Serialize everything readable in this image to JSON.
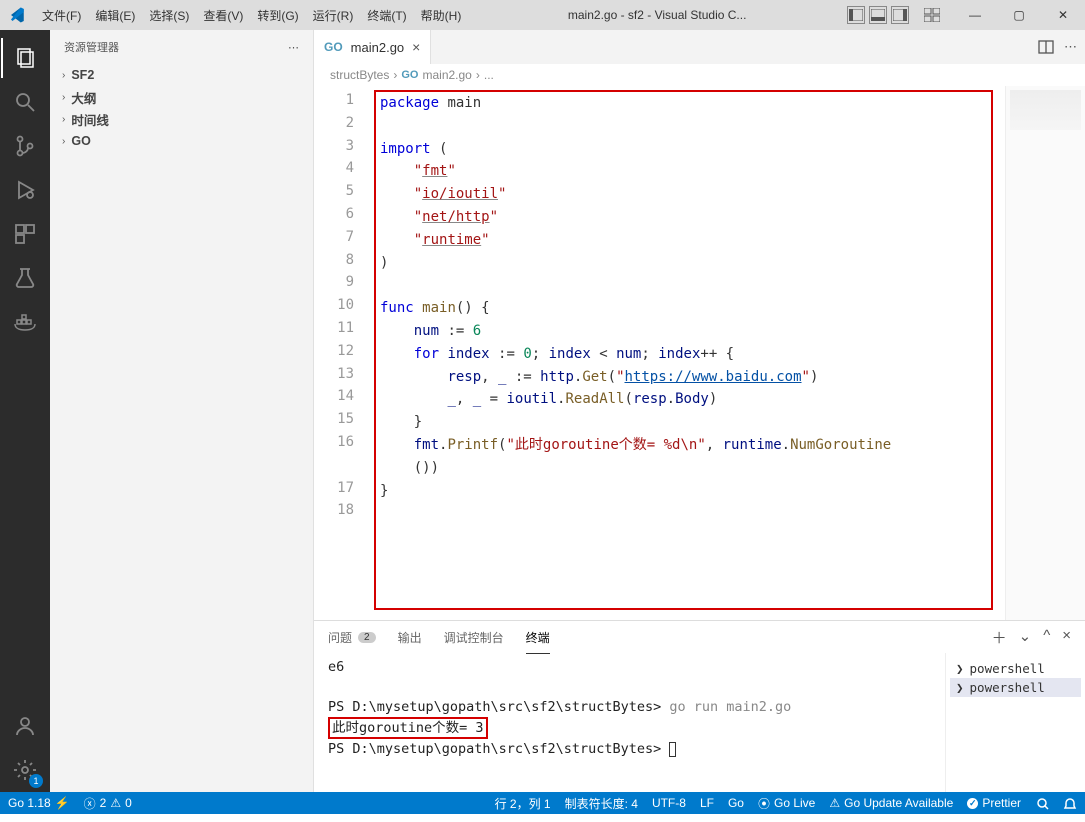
{
  "titlebar": {
    "menus": [
      "文件(F)",
      "编辑(E)",
      "选择(S)",
      "查看(V)",
      "转到(G)",
      "运行(R)",
      "终端(T)",
      "帮助(H)"
    ],
    "title": "main2.go - sf2 - Visual Studio C..."
  },
  "sidebar": {
    "title": "资源管理器",
    "sections": [
      "SF2",
      "大纲",
      "时间线",
      "GO"
    ]
  },
  "tab": {
    "icon": "GO",
    "name": "main2.go"
  },
  "breadcrumb": {
    "p0": "structBytes",
    "icon": "GO",
    "p1": "main2.go",
    "tail": "..."
  },
  "code": {
    "lines": 18,
    "l1": {
      "a": "package",
      "b": " main"
    },
    "l3": {
      "a": "import",
      "b": " ("
    },
    "l4": {
      "pad": "    ",
      "q": "\"",
      "s": "fmt"
    },
    "l5": {
      "pad": "    ",
      "q": "\"",
      "s": "io/ioutil"
    },
    "l6": {
      "pad": "    ",
      "q": "\"",
      "s": "net/http"
    },
    "l7": {
      "pad": "    ",
      "q": "\"",
      "s": "runtime"
    },
    "l8": ")",
    "l10": {
      "a": "func",
      "b": " ",
      "c": "main",
      "d": "() {"
    },
    "l11": {
      "pad": "    ",
      "a": "num",
      "b": " := ",
      "c": "6"
    },
    "l12": {
      "pad": "    ",
      "a": "for",
      "b": " ",
      "c": "index",
      "d": " := ",
      "e": "0",
      "f": "; ",
      "g": "index",
      "h": " < ",
      "i": "num",
      "j": "; ",
      "k": "index",
      "l": "++ {"
    },
    "l13": {
      "pad": "        ",
      "a": "resp",
      "b": ", ",
      "c": "_",
      "d": " := ",
      "e": "http",
      "f": ".",
      "g": "Get",
      "h": "(",
      "q": "\"",
      "url": "https://www.baidu.com",
      "i": ")"
    },
    "l14": {
      "pad": "        ",
      "a": "_",
      "b": ", ",
      "c": "_",
      "d": " = ",
      "e": "ioutil",
      "f": ".",
      "g": "ReadAll",
      "h": "(",
      "i": "resp",
      "j": ".",
      "k": "Body",
      "l": ")"
    },
    "l15": {
      "pad": "    ",
      "a": "}"
    },
    "l16": {
      "pad": "    ",
      "a": "fmt",
      "b": ".",
      "c": "Printf",
      "d": "(",
      "s": "\"此时goroutine个数= %d\\n\"",
      "e": ", ",
      "f": "runtime",
      "g": ".",
      "h": "NumGoroutine"
    },
    "l16b": {
      "pad": "    ",
      "a": "())"
    },
    "l17": "}"
  },
  "panel": {
    "tabs": {
      "problems": "问题",
      "problems_badge": "2",
      "output": "输出",
      "debug": "调试控制台",
      "terminal": "终端"
    },
    "terminal": {
      "l0": "e6",
      "l2a": "PS D:\\mysetup\\gopath\\src\\sf2\\structBytes> ",
      "l2b": "go run main2.go",
      "l3": "此时goroutine个数= 3",
      "l4": "PS D:\\mysetup\\gopath\\src\\sf2\\structBytes> "
    },
    "side": [
      "powershell",
      "powershell"
    ]
  },
  "status": {
    "go": "Go 1.18",
    "err": "2",
    "warn": "0",
    "pos": "行 2，列 1",
    "tab": "制表符长度: 4",
    "enc": "UTF-8",
    "eol": "LF",
    "lang": "Go",
    "live": "Go Live",
    "upd": "Go Update Available",
    "pret": "Prettier"
  }
}
